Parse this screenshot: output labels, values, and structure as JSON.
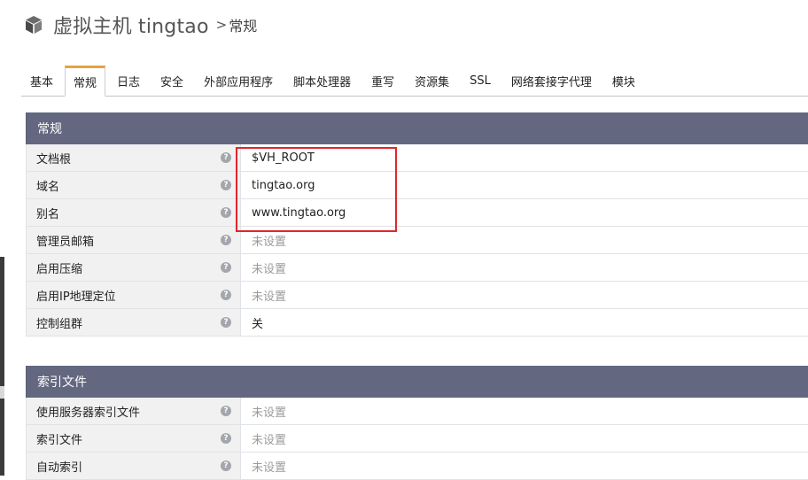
{
  "header": {
    "title": "虚拟主机 tingtao",
    "separator": ">",
    "current": "常规",
    "icon": "box-icon"
  },
  "tabs": [
    {
      "label": "基本",
      "active": false
    },
    {
      "label": "常规",
      "active": true
    },
    {
      "label": "日志",
      "active": false
    },
    {
      "label": "安全",
      "active": false
    },
    {
      "label": "外部应用程序",
      "active": false
    },
    {
      "label": "脚本处理器",
      "active": false
    },
    {
      "label": "重写",
      "active": false
    },
    {
      "label": "资源集",
      "active": false
    },
    {
      "label": "SSL",
      "active": false
    },
    {
      "label": "网络套接字代理",
      "active": false
    },
    {
      "label": "模块",
      "active": false
    }
  ],
  "sections": [
    {
      "title": "常规",
      "rows": [
        {
          "label": "文档根",
          "value": "$VH_ROOT",
          "unset": false
        },
        {
          "label": "域名",
          "value": "tingtao.org",
          "unset": false
        },
        {
          "label": "别名",
          "value": "www.tingtao.org",
          "unset": false
        },
        {
          "label": "管理员邮箱",
          "value": "未设置",
          "unset": true
        },
        {
          "label": "启用压缩",
          "value": "未设置",
          "unset": true
        },
        {
          "label": "启用IP地理定位",
          "value": "未设置",
          "unset": true
        },
        {
          "label": "控制组群",
          "value": "关",
          "unset": false
        }
      ]
    },
    {
      "title": "索引文件",
      "rows": [
        {
          "label": "使用服务器索引文件",
          "value": "未设置",
          "unset": true
        },
        {
          "label": "索引文件",
          "value": "未设置",
          "unset": true
        },
        {
          "label": "自动索引",
          "value": "未设置",
          "unset": true
        }
      ]
    }
  ],
  "colors": {
    "panel_header": "#636880",
    "active_tab_accent": "#e8a33a",
    "highlight": "#e0262b",
    "unset_text": "#9b9b9b"
  }
}
